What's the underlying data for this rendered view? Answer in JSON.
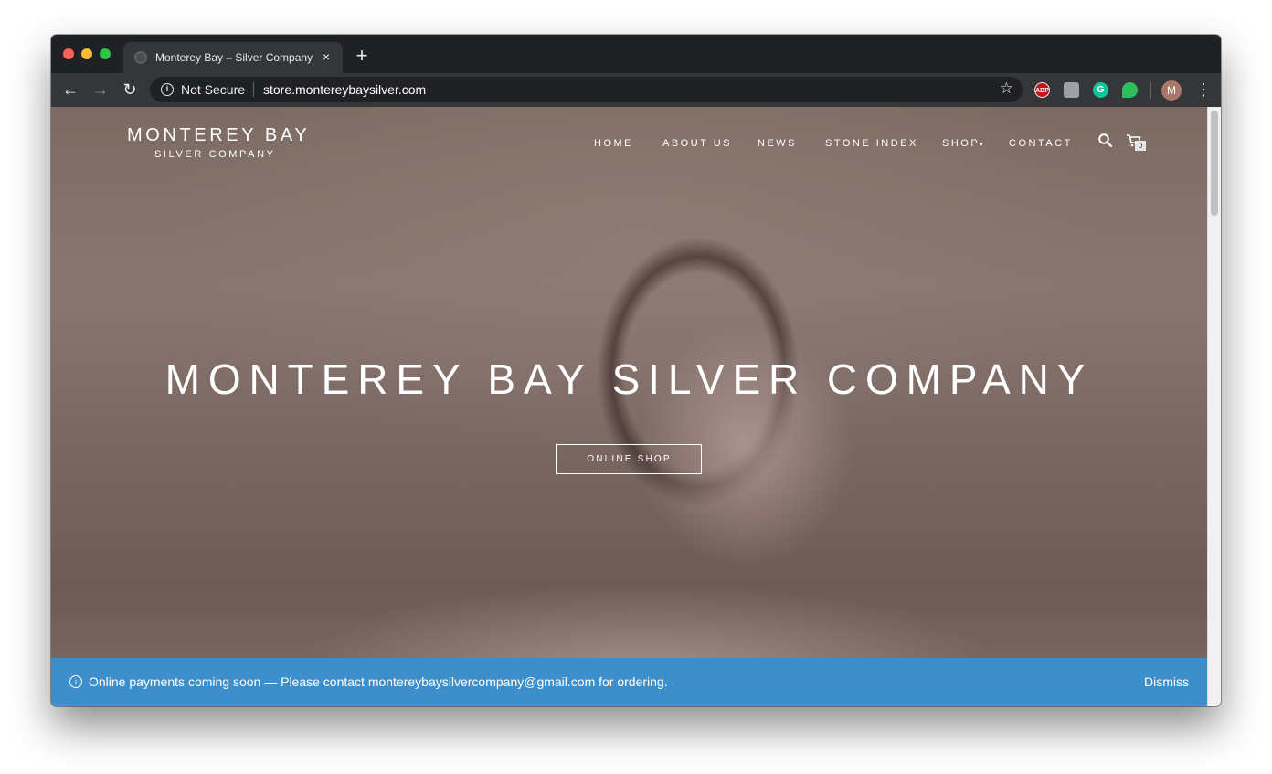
{
  "browser": {
    "tab": {
      "title": "Monterey Bay – Silver Company",
      "close_glyph": "×"
    },
    "new_tab_glyph": "+",
    "nav": {
      "back_glyph": "←",
      "forward_glyph": "→",
      "reload_glyph": "↻"
    },
    "omnibox": {
      "info_glyph": "i",
      "security_label": "Not Secure",
      "url": "store.montereybaysilver.com",
      "star_glyph": "☆"
    },
    "extensions": [
      {
        "icon": "adblock-plus-icon",
        "text": "ABP"
      },
      {
        "icon": "extension-puzzle-icon",
        "text": ""
      },
      {
        "icon": "grammarly-icon",
        "text": "G"
      },
      {
        "icon": "evernote-icon",
        "text": ""
      }
    ],
    "profile_initial": "M",
    "menu_glyph": "⋮"
  },
  "site": {
    "logo": {
      "line1": "MONTEREY BAY",
      "line2": "SILVER COMPANY"
    },
    "nav": {
      "home": "HOME",
      "about": "ABOUT US",
      "news": "NEWS",
      "stone_index": "STONE INDEX",
      "shop": "SHOP",
      "shop_caret": "▾",
      "contact": "CONTACT"
    },
    "cart_count": "0",
    "hero": {
      "title": "MONTEREY BAY SILVER COMPANY",
      "button_label": "ONLINE SHOP"
    },
    "notice": {
      "icon_glyph": "i",
      "text": "Online payments coming soon — Please contact montereybaysilvercompany@gmail.com for ordering.",
      "dismiss_label": "Dismiss"
    }
  },
  "colors": {
    "notice_bg": "#3d8fcb",
    "browser_frame": "#202124",
    "toolbar": "#35363a"
  }
}
